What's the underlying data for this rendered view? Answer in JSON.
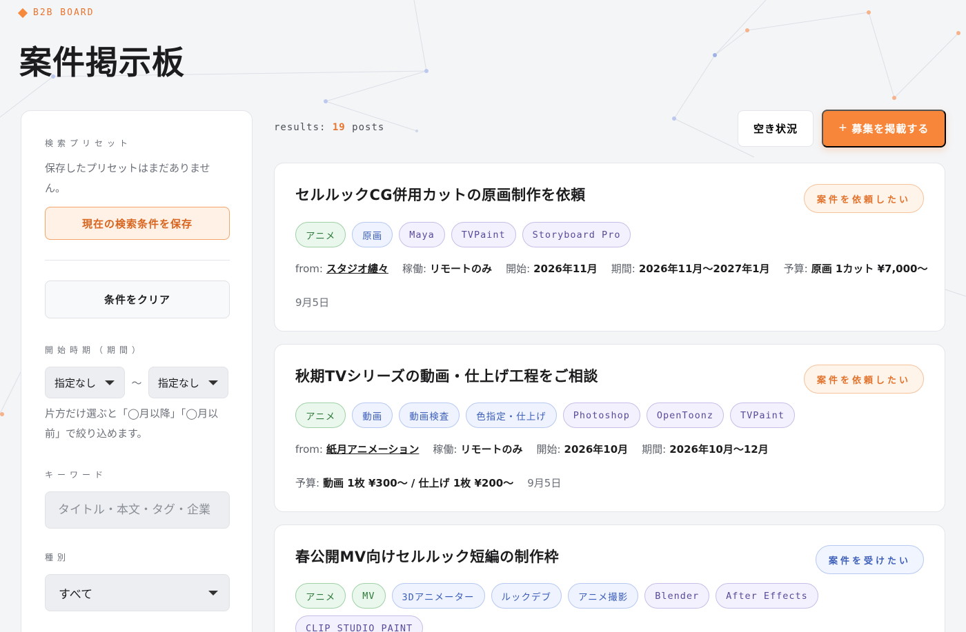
{
  "brand": {
    "label": "B2B BOARD",
    "accent": "#f58a3c"
  },
  "page": {
    "title": "案件掲示板"
  },
  "sidebar": {
    "presets_label": "検索プリセット",
    "presets_empty": "保存したプリセットはまだありません。",
    "save_button": "現在の検索条件を保存",
    "clear_button": "条件をクリア",
    "period_label": "開始時期（期間）",
    "period_from": "指定なし",
    "period_sep": "〜",
    "period_to": "指定なし",
    "period_hint": "片方だけ選ぶと「◯月以降」「◯月以前」で絞り込めます。",
    "keyword_label": "キーワード",
    "keyword_placeholder": "タイトル・本文・タグ・企業",
    "type_label": "種別",
    "type_value": "すべて"
  },
  "toolbar": {
    "results_prefix": "results:",
    "results_count": "19",
    "results_suffix": "posts",
    "availability_button": "空き状況",
    "post_button": "募集を掲載する",
    "post_button_icon": "plus-icon"
  },
  "posts": [
    {
      "title": "セルルックCG併用カットの原画制作を依頼",
      "badge": "案件を依頼したい",
      "tags": [
        "アニメ",
        "原画",
        "Maya",
        "TVPaint",
        "Storyboard Pro"
      ],
      "from_label": "from:",
      "from": "スタジオ縷々",
      "work_label": "稼働:",
      "work": "リモートのみ",
      "start_label": "開始:",
      "start": "2026年11月",
      "period_label": "期間:",
      "period": "2026年11月〜2027年1月",
      "budget_label": "予算:",
      "budget": "原画 1カット ¥7,000〜",
      "date": "9月5日"
    },
    {
      "title": "秋期TVシリーズの動画・仕上げ工程をご相談",
      "badge": "案件を依頼したい",
      "tags": [
        "アニメ",
        "動画",
        "動画検査",
        "色指定・仕上げ",
        "Photoshop",
        "OpenToonz",
        "TVPaint"
      ],
      "from_label": "from:",
      "from": "紙月アニメーション",
      "work_label": "稼働:",
      "work": "リモートのみ",
      "start_label": "開始:",
      "start": "2026年10月",
      "period_label": "期間:",
      "period": "2026年10月〜12月",
      "budget_label": "予算:",
      "budget": "動画 1枚 ¥300〜 / 仕上げ 1枚 ¥200〜",
      "date": "9月5日"
    },
    {
      "title": "春公開MV向けセルルック短編の制作枠",
      "badge": "案件を受けたい",
      "tags": [
        "アニメ",
        "MV",
        "3Dアニメーター",
        "ルックデブ",
        "アニメ撮影",
        "Blender",
        "After Effects",
        "CLIP STUDIO PAINT"
      ]
    }
  ]
}
